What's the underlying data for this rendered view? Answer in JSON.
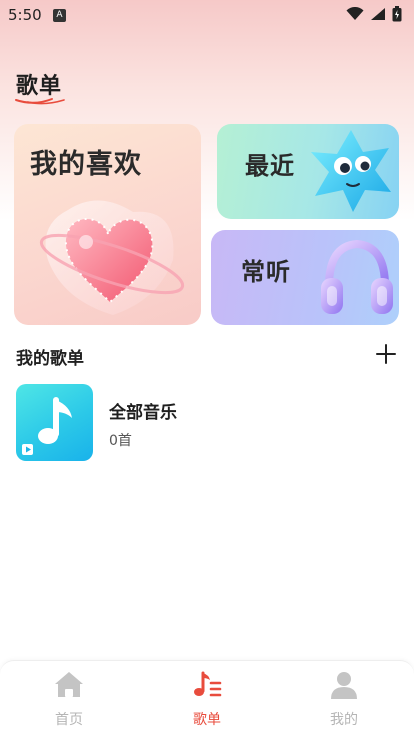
{
  "status_bar": {
    "time": "5:50",
    "notif_icon": "A"
  },
  "page": {
    "title": "歌单"
  },
  "cards": {
    "favorites": {
      "label": "我的喜欢",
      "icon": "heart-art"
    },
    "recent": {
      "label": "最近",
      "icon": "star-creature-art"
    },
    "frequent": {
      "label": "常听",
      "icon": "headphones-art"
    }
  },
  "my_playlists": {
    "header": "我的歌单",
    "add_icon": "plus-icon",
    "items": [
      {
        "name": "全部音乐",
        "count": "0首"
      }
    ]
  },
  "bottom_nav": {
    "items": [
      {
        "label": "首页",
        "icon": "home-icon",
        "active": false
      },
      {
        "label": "歌单",
        "icon": "music-list-icon",
        "active": true
      },
      {
        "label": "我的",
        "icon": "person-icon",
        "active": false
      }
    ]
  },
  "colors": {
    "accent": "#e84c3d",
    "inactive": "#b5b5b5"
  }
}
